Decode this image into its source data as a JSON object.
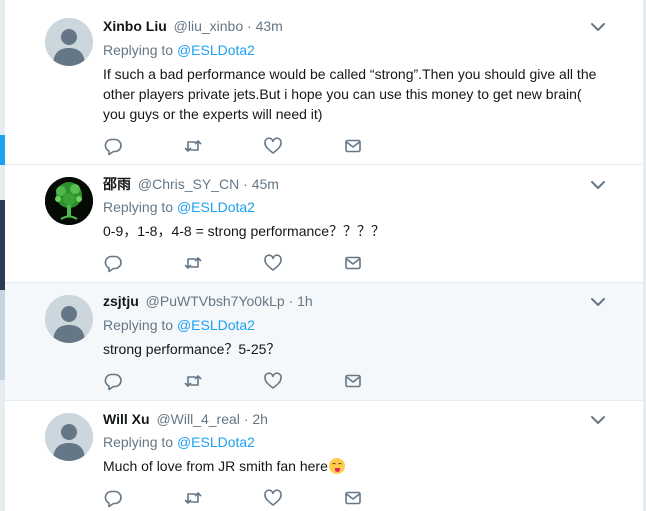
{
  "tweets": [
    {
      "name": "Xinbo Liu",
      "handle": "@liu_xinbo",
      "time": "43m",
      "replying_prefix": "Replying to",
      "replying_to": "@ESLDota2",
      "text_lines": [
        "If such a bad performance would be called “strong”.Then you should give all the",
        "other players private jets.But i hope you can use this money to get new brain(",
        "you guys or the experts will need it)"
      ],
      "avatar": "default-avatar"
    },
    {
      "name": "邵雨",
      "handle": "@Chris_SY_CN",
      "time": "45m",
      "replying_prefix": "Replying to",
      "replying_to": "@ESLDota2",
      "text_lines": [
        "0-9，1-8，4-8 = strong performance？？？？"
      ],
      "avatar": "green-tree-avatar"
    },
    {
      "name": "zsjtju",
      "handle": "@PuWTVbsh7Yo0kLp",
      "time": "1h",
      "replying_prefix": "Replying to",
      "replying_to": "@ESLDota2",
      "text_lines": [
        "strong performance？5-25？"
      ],
      "avatar": "default-avatar"
    },
    {
      "name": "Will Xu",
      "handle": "@Will_4_real",
      "time": "2h",
      "replying_prefix": "Replying to",
      "replying_to": "@ESLDota2",
      "text_lines": [
        "Much of love from JR smith fan here"
      ],
      "emoji": "face-savoring-food-emoji",
      "avatar": "default-avatar"
    }
  ],
  "icons": {
    "reply": "reply-icon",
    "retweet": "retweet-icon",
    "like": "heart-icon",
    "dm": "envelope-icon",
    "more": "chevron-down-icon"
  },
  "colors": {
    "link": "#1da1f2",
    "secondary_text": "#657786",
    "hover_background": "#f5f8fa",
    "divider": "#e6ecf0"
  }
}
